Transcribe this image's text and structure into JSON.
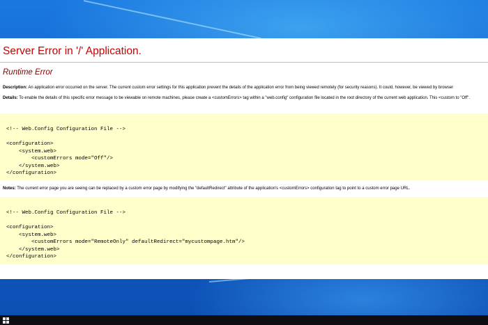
{
  "page": {
    "title": "Server Error in '/' Application.",
    "subtitle": "Runtime Error",
    "description": {
      "label": "Description:",
      "text": " An application error occurred on the server. The current custom error settings for this application prevent the details of the application error from being viewed remotely (for security reasons). It could, however, be viewed by browser"
    },
    "details": {
      "label": "Details:",
      "text": " To enable the details of this specific error message to be viewable on remote machines, please create a <customErrors> tag within a \"web.config\" configuration file located in the root directory of the current web application. This <custom to \"Off\"."
    },
    "code_block_1": "<!-- Web.Config Configuration File -->\n\n<configuration>\n    <system.web>\n        <customErrors mode=\"Off\"/>\n    </system.web>\n</configuration>",
    "notes": {
      "label": "Notes:",
      "text": " The current error page you are seeing can be replaced by a custom error page by modifying the \"defaultRedirect\" attribute of the application's <customErrors> configuration tag to point to a custom error page URL."
    },
    "code_block_2": "<!-- Web.Config Configuration File -->\n\n<configuration>\n    <system.web>\n        <customErrors mode=\"RemoteOnly\" defaultRedirect=\"mycustompage.htm\"/>\n    </system.web>\n</configuration>"
  },
  "taskbar": {
    "start_icon": "windows-logo"
  },
  "colors": {
    "title": "#cc0000",
    "subtitle": "#800000",
    "code_background": "#ffffcc",
    "desktop": "#1360c8",
    "taskbar": "#0d0d12"
  }
}
